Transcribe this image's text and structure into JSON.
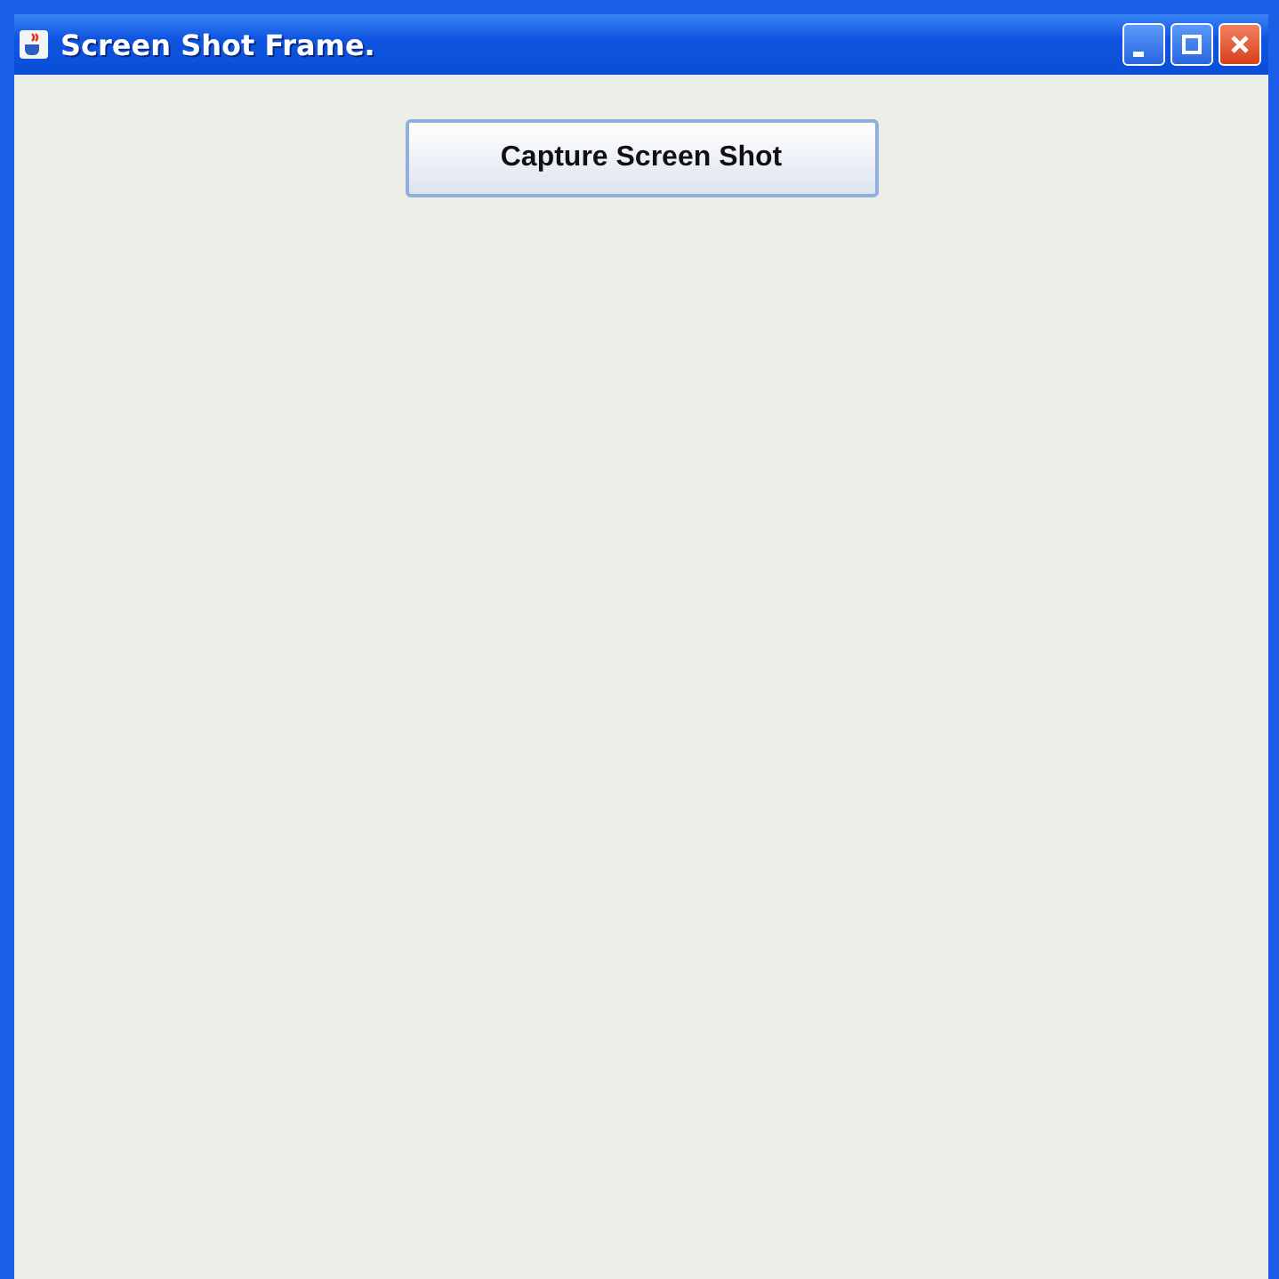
{
  "window": {
    "title": "Screen Shot Frame."
  },
  "capture_button": {
    "label": "Capture Screen Shot"
  }
}
